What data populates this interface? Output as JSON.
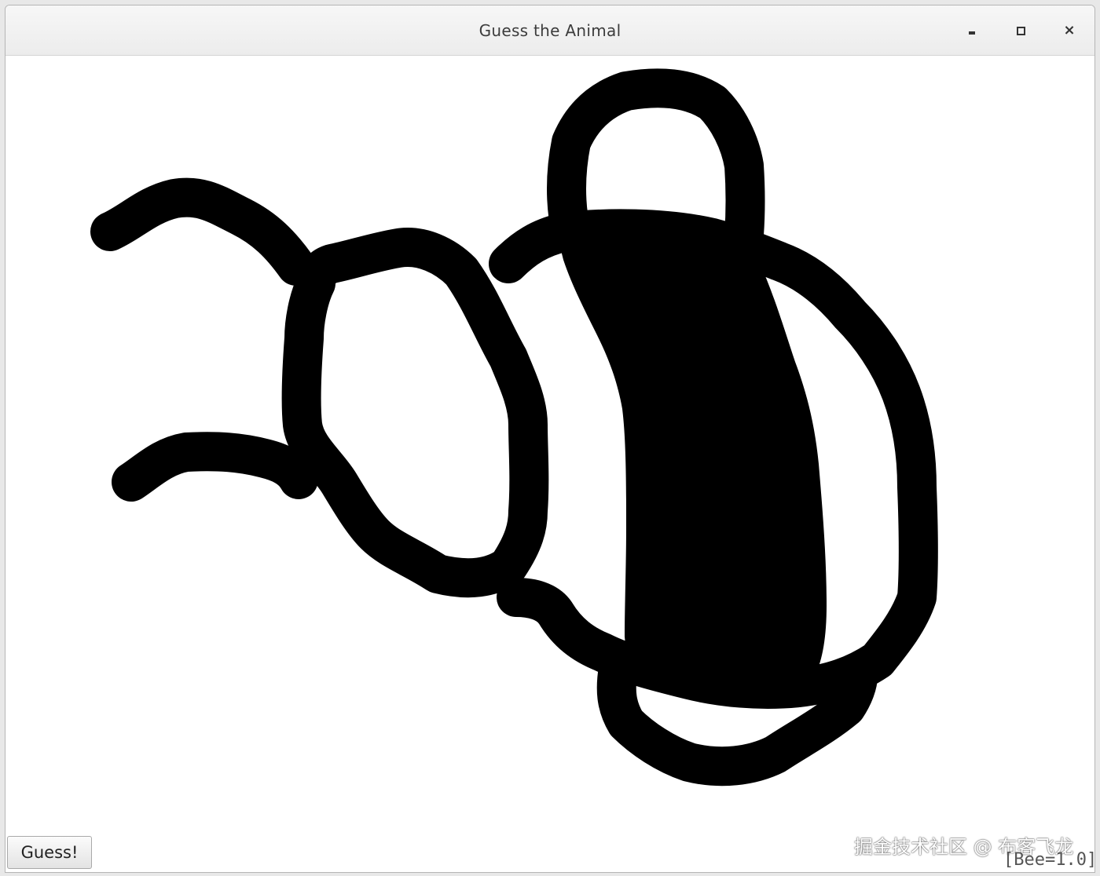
{
  "window": {
    "title": "Guess the Animal",
    "controls": {
      "minimize_icon": "minimize-icon",
      "maximize_icon": "maximize-icon",
      "close_icon": "close-icon",
      "close_glyph": "×"
    }
  },
  "canvas": {
    "stroke_color": "#000000",
    "background_color": "#ffffff"
  },
  "buttons": {
    "guess_label": "Guess!"
  },
  "watermark": "掘金技术社区 @ 布客飞龙",
  "prediction": "[Bee=1.0]"
}
